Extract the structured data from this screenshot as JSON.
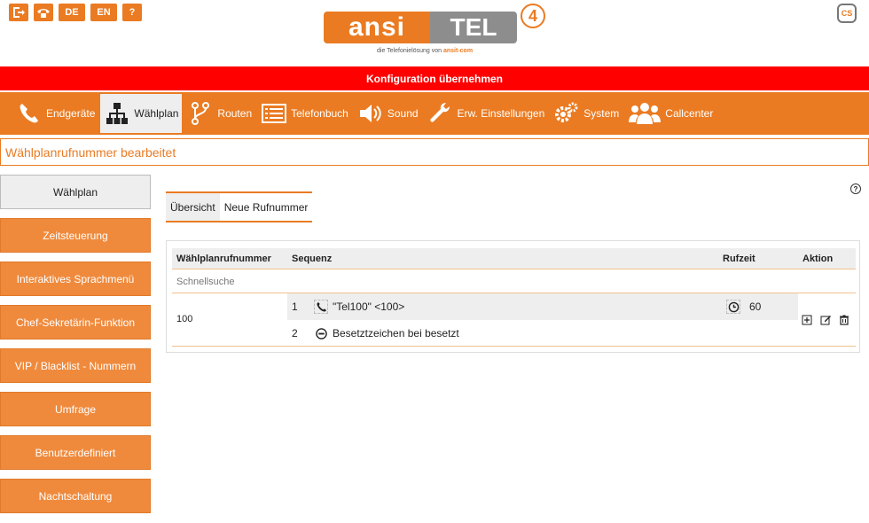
{
  "quick_icons": {
    "lang_de": "DE",
    "lang_en": "EN",
    "help": "?"
  },
  "logo": {
    "left_text": "ansi",
    "right_text": "TEL",
    "version": "4",
    "tagline": "die Telefonielösung von",
    "tagline_brand": "ansit-com"
  },
  "cs_label": "CS",
  "config_bar": "Konfiguration übernehmen",
  "nav": [
    {
      "label": "Endgeräte"
    },
    {
      "label": "Wählplan"
    },
    {
      "label": "Routen"
    },
    {
      "label": "Telefonbuch"
    },
    {
      "label": "Sound"
    },
    {
      "label": "Erw. Einstellungen"
    },
    {
      "label": "System"
    },
    {
      "label": "Callcenter"
    }
  ],
  "status": "Wählplanrufnummer bearbeitet",
  "sidebar": [
    {
      "label": "Wählplan"
    },
    {
      "label": "Zeitsteuerung"
    },
    {
      "label": "Interaktives Sprachmenü"
    },
    {
      "label": "Chef-Sekretärin-Funktion"
    },
    {
      "label": "VIP / Blacklist - Nummern"
    },
    {
      "label": "Umfrage"
    },
    {
      "label": "Benutzerdefiniert"
    },
    {
      "label": "Nachtschaltung"
    }
  ],
  "help_symbol": "?",
  "subtabs": [
    {
      "label": "Übersicht"
    },
    {
      "label": "Neue Rufnummer"
    }
  ],
  "table": {
    "headers": {
      "number": "Wählplanrufnummer",
      "sequence": "Sequenz",
      "ring_time": "Rufzeit",
      "action": "Aktion"
    },
    "quick_search": "Schnellsuche",
    "row": {
      "number": "100",
      "steps": [
        {
          "index": "1",
          "icon": "phone-icon",
          "text": "\"Tel100\" <100>",
          "ring_time": "60"
        },
        {
          "index": "2",
          "icon": "busy-icon",
          "text": "Besetztzeichen bei besetzt"
        }
      ]
    }
  },
  "colors": {
    "accent": "#ea7b22",
    "config_bar": "#ff0000",
    "active_bg": "#eeeeee"
  }
}
